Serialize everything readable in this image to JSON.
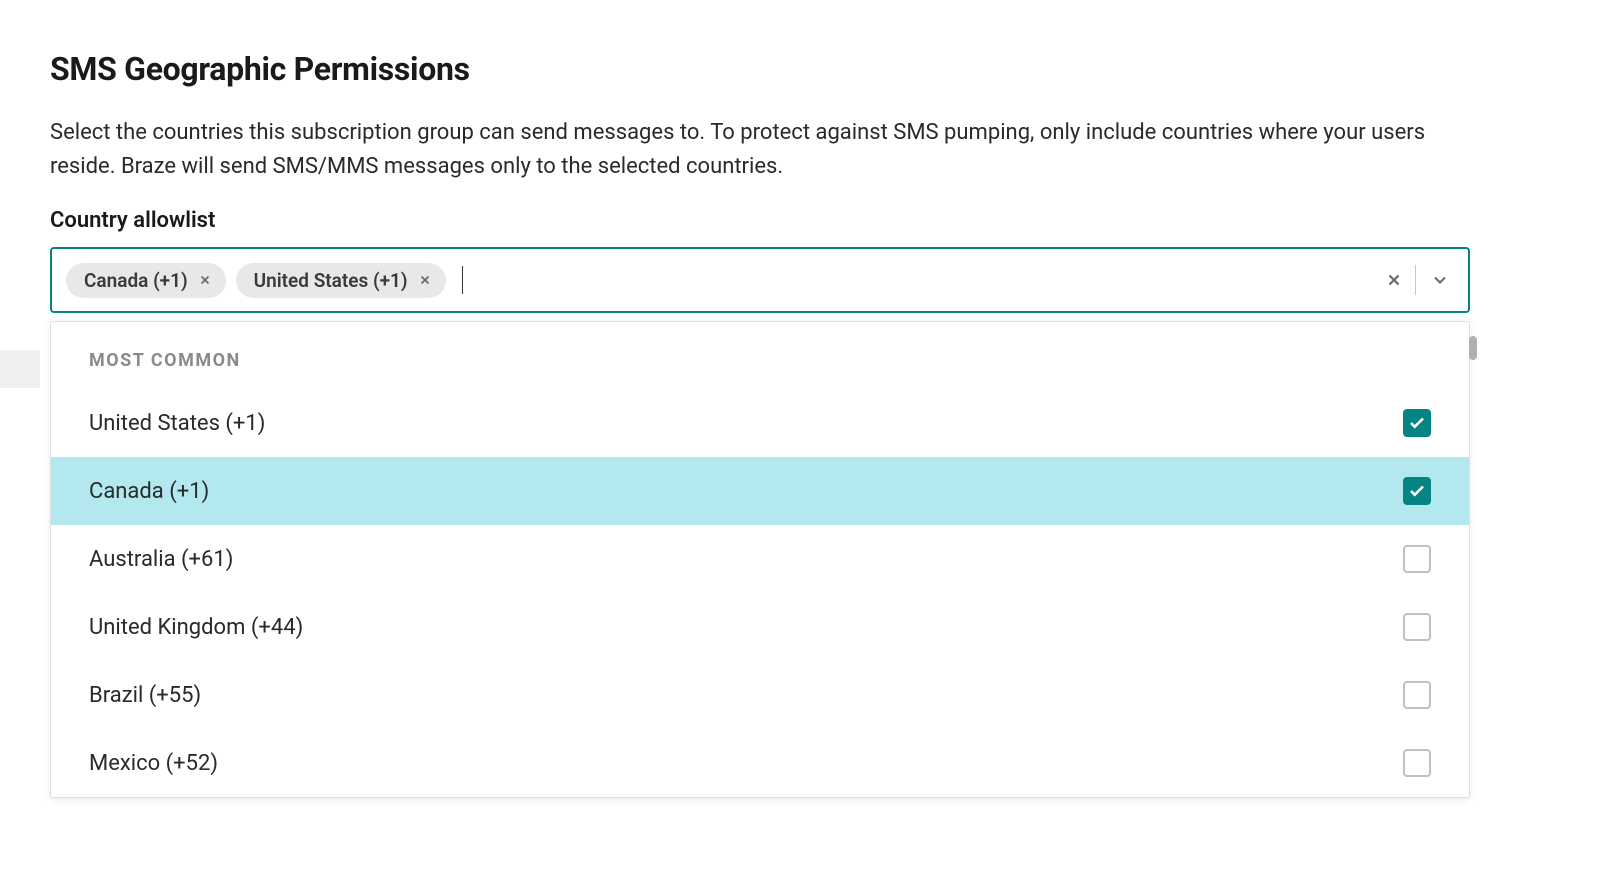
{
  "title": "SMS Geographic Permissions",
  "description": "Select the countries this subscription group can send messages to. To protect against SMS pumping, only include countries where your users reside. Braze will send SMS/MMS messages only to the selected countries.",
  "field_label": "Country allowlist",
  "selected_chips": [
    {
      "label": "Canada (+1)"
    },
    {
      "label": "United States (+1)"
    }
  ],
  "dropdown": {
    "section_header": "MOST COMMON",
    "options": [
      {
        "label": "United States (+1)",
        "checked": true,
        "highlighted": false
      },
      {
        "label": "Canada (+1)",
        "checked": true,
        "highlighted": true
      },
      {
        "label": "Australia (+61)",
        "checked": false,
        "highlighted": false
      },
      {
        "label": "United Kingdom (+44)",
        "checked": false,
        "highlighted": false
      },
      {
        "label": "Brazil (+55)",
        "checked": false,
        "highlighted": false
      },
      {
        "label": "Mexico (+52)",
        "checked": false,
        "highlighted": false
      }
    ]
  }
}
